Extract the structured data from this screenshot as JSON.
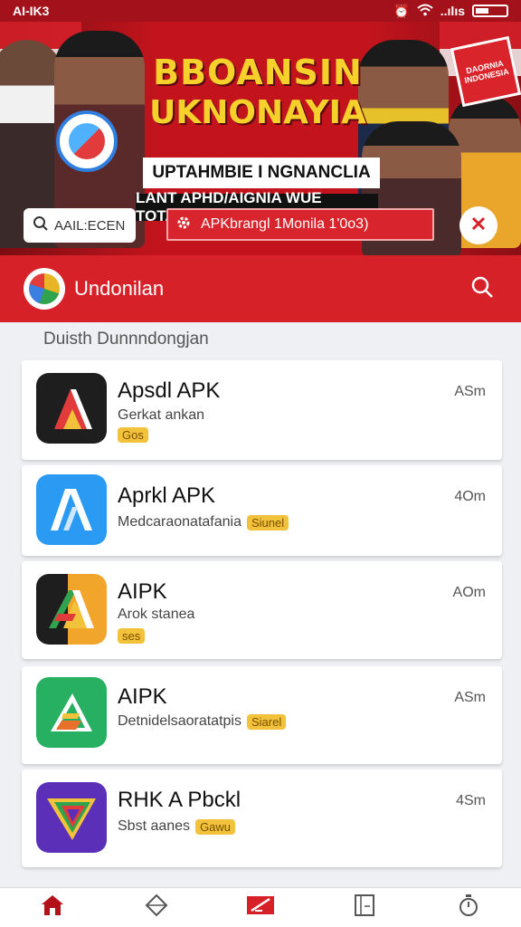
{
  "status_bar": {
    "left_text": "AI-IK3",
    "signal_text": "..ılıs"
  },
  "banner": {
    "title_line1": "BBOANSIN",
    "title_line2": "UKNONAYIA",
    "subtitle_white": "UPTAHMBIE I NGNANCLIA",
    "subtitle_black": "LANT APHD/AIGNIA WUE TOTAIG",
    "corner_badge": "DAORNIA INDONESIA",
    "search_label": "AAIL:ECEN",
    "cta_label": "APKbrangl 1Monila 1'0o3)"
  },
  "app_bar": {
    "title": "Undonilan"
  },
  "section_title": "Duisth Dunnndongjan",
  "apps": [
    {
      "name": "Apsdl APK",
      "subtitle": "Gerkat ankan",
      "tag": "Gos",
      "size": "ASm"
    },
    {
      "name": "Aprkl APK",
      "subtitle": "Medcaraonatafania",
      "tag": "Siunel",
      "size": "4Om"
    },
    {
      "name": "AIPK",
      "subtitle": "Arok stanea",
      "tag": "ses",
      "size": "AOm"
    },
    {
      "name": "AIPK",
      "subtitle": "Detnidelsaoratatpis",
      "tag": "Siarel",
      "size": "ASm"
    },
    {
      "name": "RHK A Pbckl",
      "subtitle": "Sbst aanes",
      "tag": "Gawu",
      "size": "4Sm"
    }
  ],
  "icons": {
    "home": "home-icon",
    "explore": "diamond-icon",
    "featured": "apk-icon",
    "library": "book-icon",
    "timer": "stopwatch-icon"
  },
  "colors": {
    "primary_red": "#d62128",
    "accent_yellow": "#f2c33a",
    "banner_gold": "#f6d12b"
  }
}
